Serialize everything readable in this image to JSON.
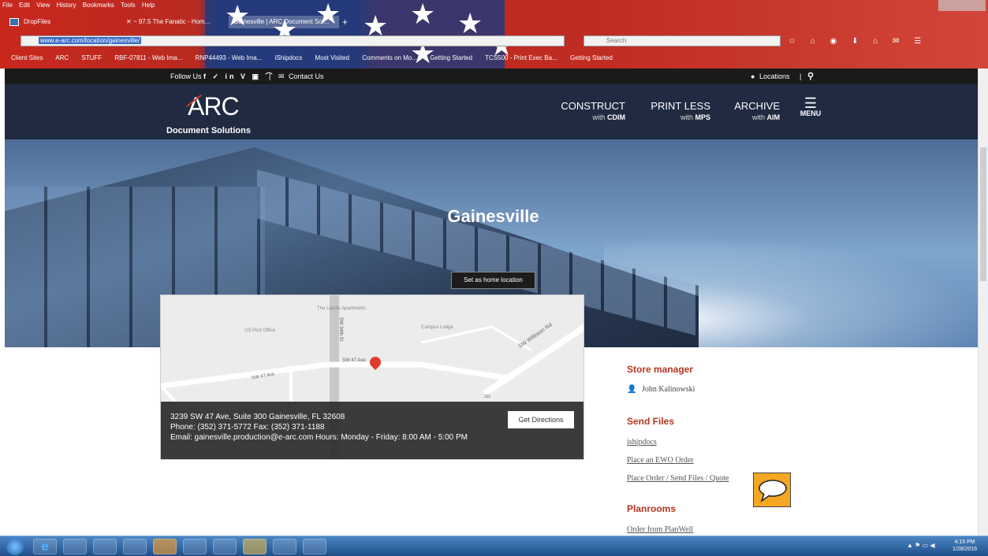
{
  "browser": {
    "menu": [
      "File",
      "Edit",
      "View",
      "History",
      "Bookmarks",
      "Tools",
      "Help"
    ],
    "tabs": [
      "DropFiles",
      "~ 97.5 The Fanatic - Hom...",
      "Gainesville | ARC Document Sol..."
    ],
    "url": "www.e-arc.com/location/gainesville/",
    "search_placeholder": "Search",
    "bookmarks": [
      "Client Sites",
      "ARC",
      "STUFF",
      "RBF-07811 - Web Ima...",
      "RNP44493 - Web Ima...",
      "iShipdocs",
      "Most Visited",
      "Comments on Mo...",
      "Getting Started",
      "TCS500 - Print Exec Ba...",
      "Getting Started"
    ]
  },
  "site": {
    "topbar": {
      "follow_label": "Follow Us",
      "contact_label": "Contact Us",
      "locations_label": "Locations"
    },
    "logo": {
      "main": "ARC",
      "sub": "Document Solutions"
    },
    "nav": [
      {
        "title": "CONSTRUCT",
        "prefix": "with",
        "bold": "CDIM"
      },
      {
        "title": "PRINT LESS",
        "prefix": "with",
        "bold": "MPS"
      },
      {
        "title": "ARCHIVE",
        "prefix": "with",
        "bold": "AIM"
      }
    ],
    "menu_label": "MENU",
    "hero_title": "Gainesville",
    "home_button": "Set as home location",
    "map": {
      "labels": [
        "The Landis Apartments",
        "Campus Lodge",
        "US Post Office",
        "SW 34th St",
        "SW 47 Ave",
        "SW 47 Ave",
        "SW Williston Rd",
        "331"
      ],
      "address": "3239 SW 47 Ave, Suite 300 Gainesville, FL 32608",
      "phone": "Phone: (352) 371-5772 Fax: (352) 371-1188",
      "email": "Email: gainesville.production@e-arc.com Hours: Monday - Friday: 8:00 AM - 5:00 PM",
      "directions_button": "Get Directions"
    },
    "store_manager_heading": "Store manager",
    "store_manager_name": "John Kalinowski",
    "send_files_heading": "Send Files",
    "send_links": [
      "ishipdocs",
      "Place an EWO Order",
      "Place Order / Send Files / Quote"
    ],
    "planrooms_heading": "Planrooms",
    "planroom_links": [
      "Order from PlanWell"
    ]
  },
  "taskbar": {
    "time": "4:15 PM",
    "date": "1/28/2016"
  },
  "colors": {
    "accent_red": "#b5361f",
    "header_dark": "#142037",
    "taskbar": "#1f4f8a"
  }
}
